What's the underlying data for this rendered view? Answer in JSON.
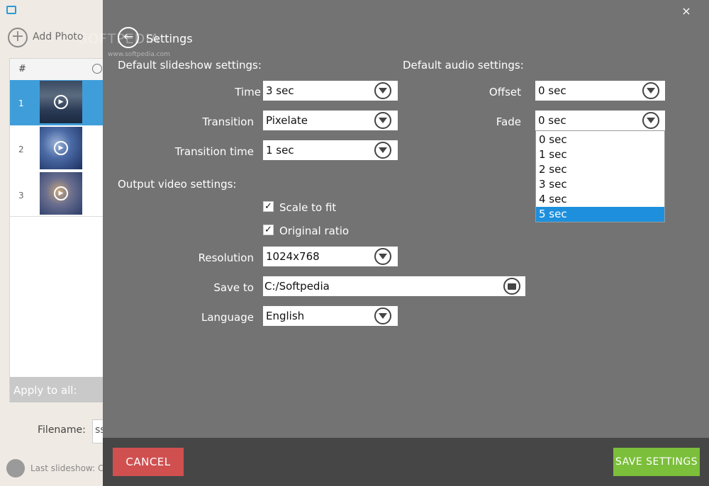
{
  "app": {
    "add_photo_label": "Add Photo",
    "grid_hash_header": "#",
    "rows": [
      {
        "num": "1"
      },
      {
        "num": "2"
      },
      {
        "num": "3"
      }
    ],
    "apply_to_all_label": "Apply to all:",
    "filename_label": "Filename:",
    "filename_value": "ss",
    "last_slideshow_label": "Last slideshow: C",
    "icons": {
      "app": "app-logo-icon",
      "add": "plus-circle-icon",
      "clock": "clock-icon",
      "play": "play-icon",
      "folder": "folder-icon"
    }
  },
  "watermark": {
    "main": "SOFTPEDIA",
    "sub": "www.softpedia.com"
  },
  "settings": {
    "title": "Settings",
    "close_label": "×",
    "back_icon": "back-arrow-icon",
    "slideshow": {
      "heading": "Default slideshow settings:",
      "time_label": "Time",
      "time_value": "3 sec",
      "transition_label": "Transition",
      "transition_value": "Pixelate",
      "transition_time_label": "Transition time",
      "transition_time_value": "1 sec"
    },
    "audio": {
      "heading": "Default audio settings:",
      "offset_label": "Offset",
      "offset_value": "0 sec",
      "fade_label": "Fade",
      "fade_value": "0 sec",
      "fade_options": [
        "0 sec",
        "1 sec",
        "2 sec",
        "3 sec",
        "4 sec",
        "5 sec"
      ],
      "fade_highlighted": "5 sec"
    },
    "output": {
      "heading": "Output video settings:",
      "scale_to_fit_label": "Scale to fit",
      "scale_to_fit_checked": true,
      "original_ratio_label": "Original ratio",
      "original_ratio_checked": true,
      "resolution_label": "Resolution",
      "resolution_value": "1024x768",
      "save_to_label": "Save to",
      "save_to_value": "C:/Softpedia",
      "language_label": "Language",
      "language_value": "English"
    },
    "cancel_label": "CANCEL",
    "save_label": "SAVE SETTINGS",
    "colors": {
      "cancel": "#d05050",
      "save": "#7bbf3a",
      "overlay": "#737373",
      "highlight": "#1e8fdc"
    }
  }
}
